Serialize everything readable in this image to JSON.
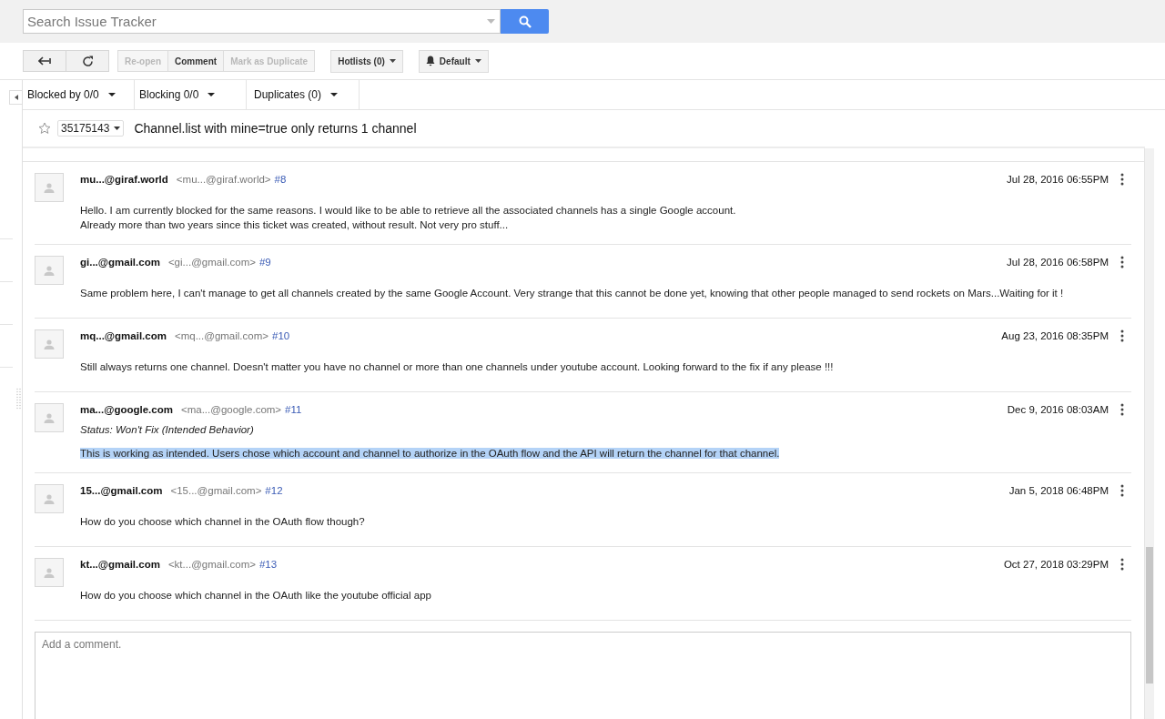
{
  "search": {
    "placeholder": "Search Issue Tracker"
  },
  "toolbar": {
    "actions": [
      {
        "label": "Re-open",
        "disabled": true
      },
      {
        "label": "Comment",
        "disabled": false
      },
      {
        "label": "Mark as Duplicate",
        "disabled": true
      }
    ],
    "hotlists": "Hotlists (0)",
    "notify": "Default"
  },
  "relations": [
    "Blocked by 0/0",
    "Blocking 0/0",
    "Duplicates (0)"
  ],
  "issue": {
    "starred": false,
    "id": "35175143",
    "title": "Channel.list with mine=true only returns 1 channel"
  },
  "comments": [
    {
      "name": "mu...@giraf.world",
      "email": "<mu...@giraf.world>",
      "number": "#8",
      "date": "Jul 28, 2016 06:55PM",
      "lines": [
        "Hello. I am currently blocked for the same reasons. I would like to be able to retrieve all the associated channels has a single Google account.",
        "Already more than two years since this ticket was created, without result. Not very pro stuff..."
      ],
      "highlighted": false
    },
    {
      "name": "gi...@gmail.com",
      "email": "<gi...@gmail.com>",
      "number": "#9",
      "date": "Jul 28, 2016 06:58PM",
      "lines": [
        "Same problem here, I can't manage to get all channels created by the same Google Account. Very strange that this cannot be done yet, knowing that other people managed to send rockets on Mars...Waiting for it !"
      ],
      "highlighted": false
    },
    {
      "name": "mq...@gmail.com",
      "email": "<mq...@gmail.com>",
      "number": "#10",
      "date": "Aug 23, 2016 08:35PM",
      "lines": [
        "Still always returns one channel. Doesn't matter you have no channel or more than one channels under youtube account. Looking forward to the fix if any please !!!"
      ],
      "highlighted": false
    },
    {
      "name": "ma...@google.com",
      "email": "<ma...@google.com>",
      "number": "#11",
      "date": "Dec 9, 2016 08:03AM",
      "status": "Status: Won't Fix (Intended Behavior)",
      "lines": [
        "This is working as intended.  Users chose which account and channel to authorize in the OAuth flow and the API will return the channel for that channel."
      ],
      "highlighted": true
    },
    {
      "name": "15...@gmail.com",
      "email": "<15...@gmail.com>",
      "number": "#12",
      "date": "Jan 5, 2018 06:48PM",
      "lines": [
        "How do you choose which channel in the OAuth flow though?"
      ],
      "highlighted": false
    },
    {
      "name": "kt...@gmail.com",
      "email": "<kt...@gmail.com>",
      "number": "#13",
      "date": "Oct 27, 2018 03:29PM",
      "lines": [
        "How do you choose which channel in the OAuth like the youtube official app"
      ],
      "highlighted": false
    }
  ],
  "composer": {
    "placeholder": "Add a comment."
  }
}
